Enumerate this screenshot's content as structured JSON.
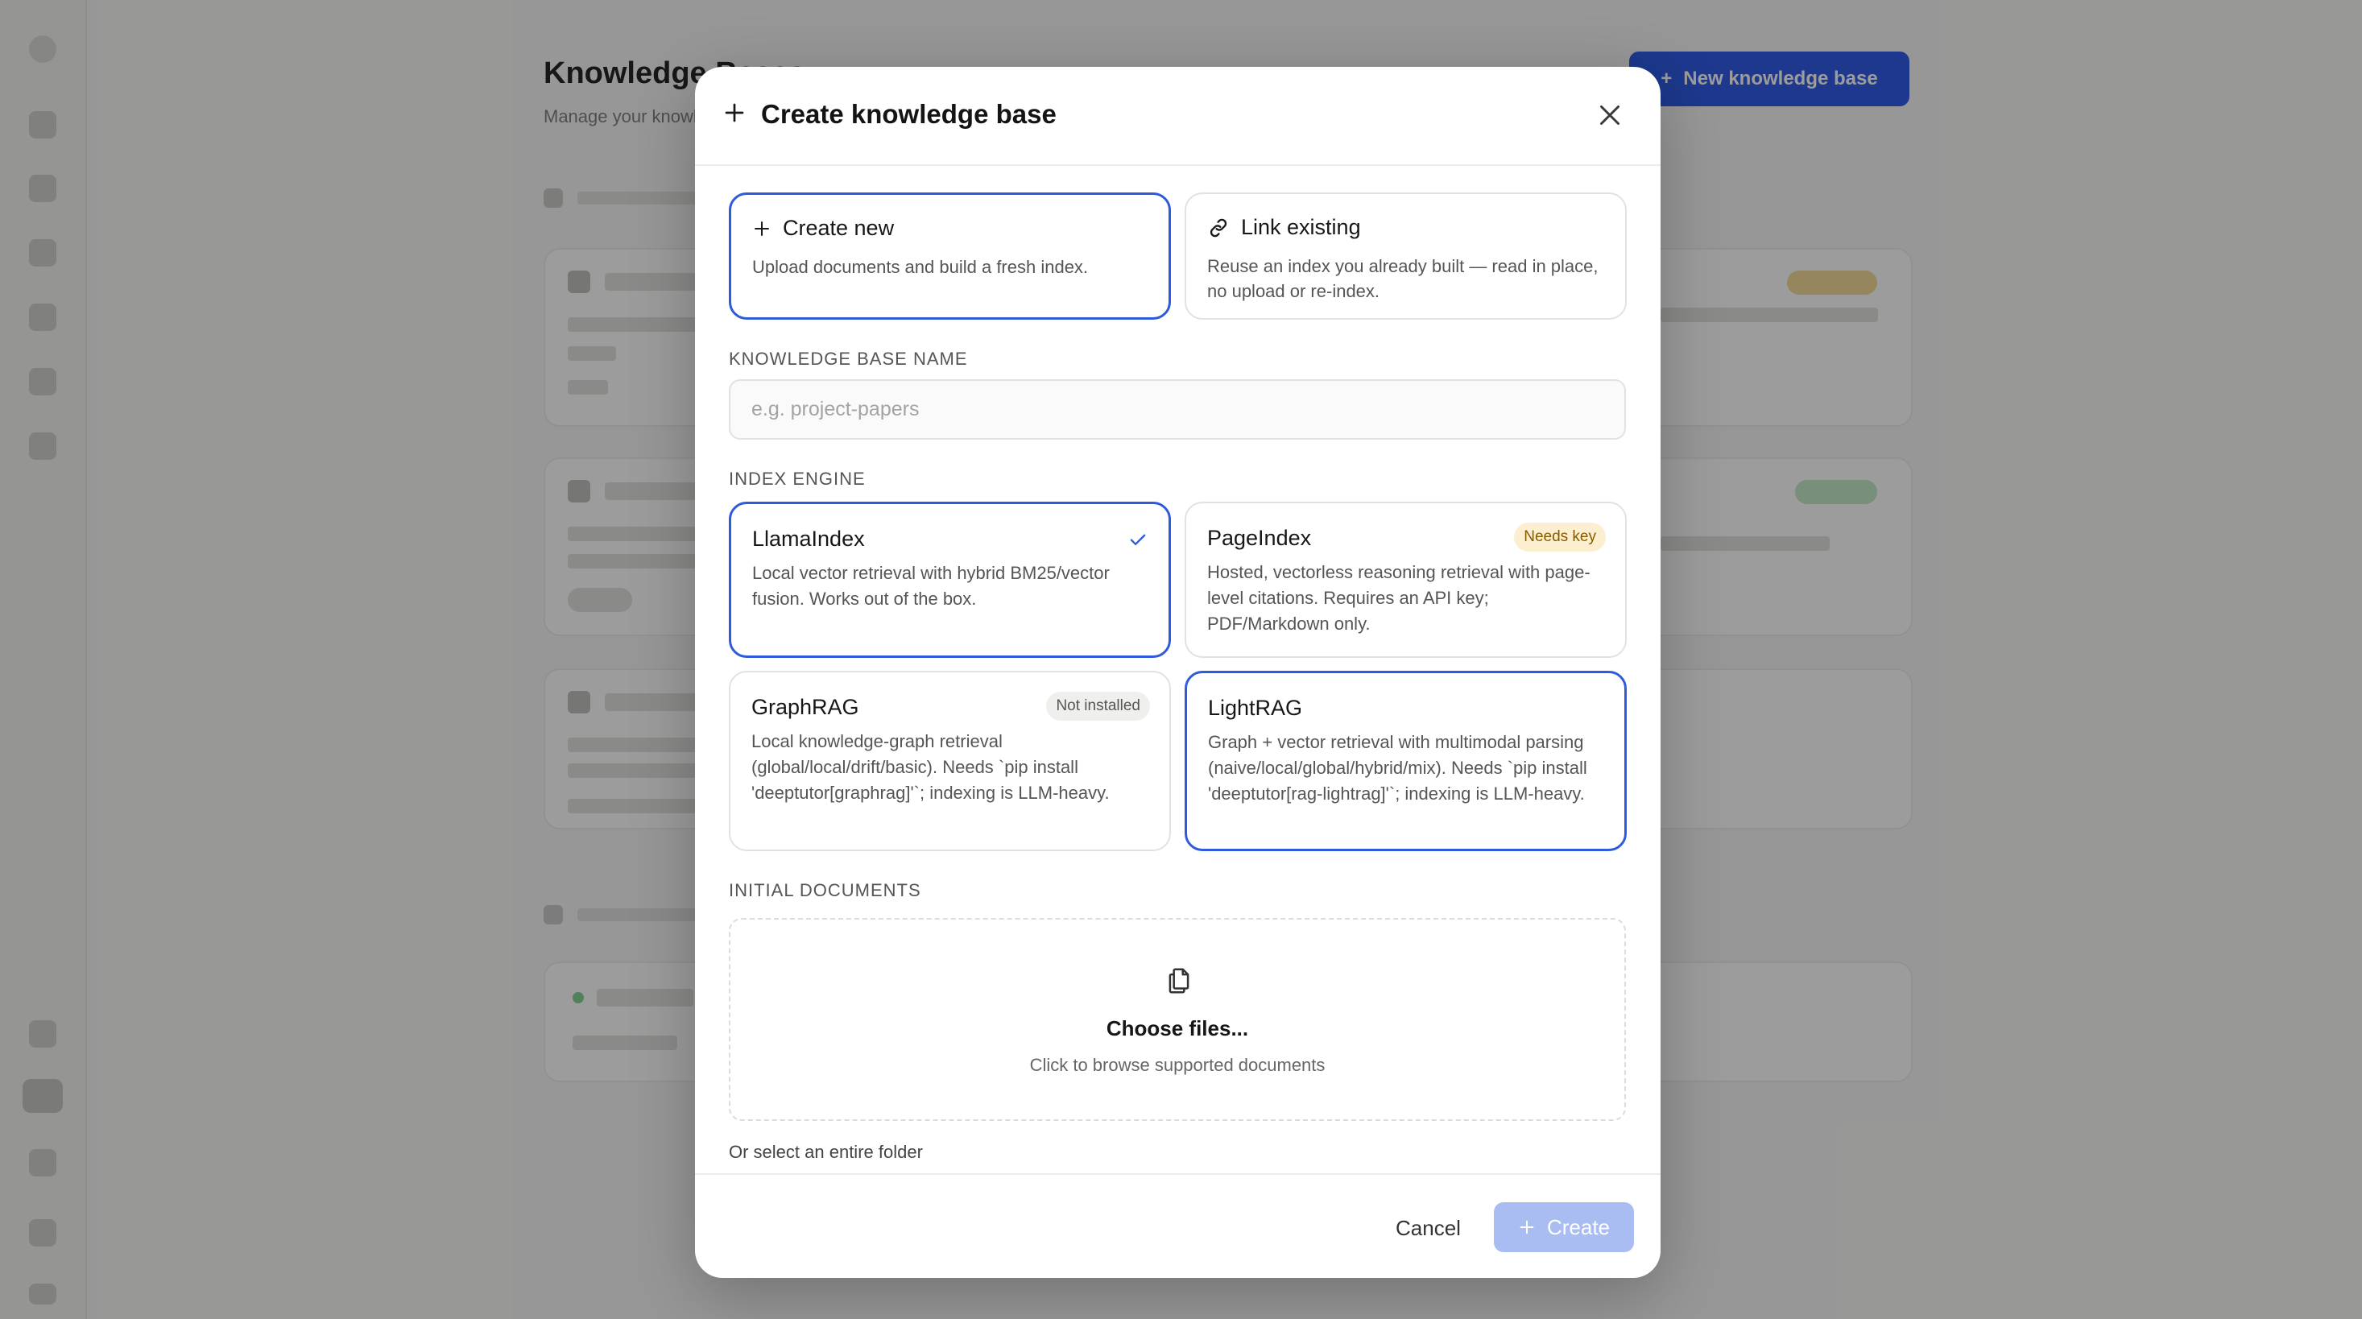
{
  "background": {
    "page_title": "Knowledge Bases",
    "page_subtitle": "Manage your knowledge bases",
    "new_button_label": "New knowledge base"
  },
  "modal": {
    "title": "Create knowledge base",
    "modes": [
      {
        "label": "Create new",
        "description": "Upload documents and build a fresh index.",
        "selected": true,
        "icon": "plus-icon"
      },
      {
        "label": "Link existing",
        "description": "Reuse an index you already built — read in place, no upload or re-index.",
        "selected": false,
        "icon": "link-icon"
      }
    ],
    "name_field": {
      "label": "KNOWLEDGE BASE NAME",
      "placeholder": "e.g. project-papers",
      "value": ""
    },
    "index_engine": {
      "label": "INDEX ENGINE",
      "engines": [
        {
          "name": "LlamaIndex",
          "description": "Local vector retrieval with hybrid BM25/vector fusion. Works out of the box.",
          "selected": true,
          "badge": ""
        },
        {
          "name": "PageIndex",
          "description": "Hosted, vectorless reasoning retrieval with page-level citations. Requires an API key; PDF/Markdown only.",
          "selected": false,
          "badge": "Needs key"
        },
        {
          "name": "GraphRAG",
          "description": "Local knowledge-graph retrieval (global/local/drift/basic). Needs `pip install 'deeptutor[graphrag]'`; indexing is LLM-heavy.",
          "selected": false,
          "badge": "Not installed"
        },
        {
          "name": "LightRAG",
          "description": "Graph + vector retrieval with multimodal parsing (naive/local/global/hybrid/mix). Needs `pip install 'deeptutor[rag-lightrag]'`; indexing is LLM-heavy.",
          "selected": false,
          "badge": ""
        }
      ]
    },
    "documents": {
      "label": "INITIAL DOCUMENTS",
      "dropzone_title": "Choose files...",
      "dropzone_subtitle": "Click to browse supported documents",
      "folder_link": "Or select an entire folder"
    },
    "footer": {
      "cancel_label": "Cancel",
      "create_label": "Create"
    }
  },
  "colors": {
    "accent": "#2f5bdb",
    "create_disabled": "#a9bdf3",
    "warning_badge_bg": "#fbefcf",
    "warning_badge_text": "#8a5a00"
  }
}
